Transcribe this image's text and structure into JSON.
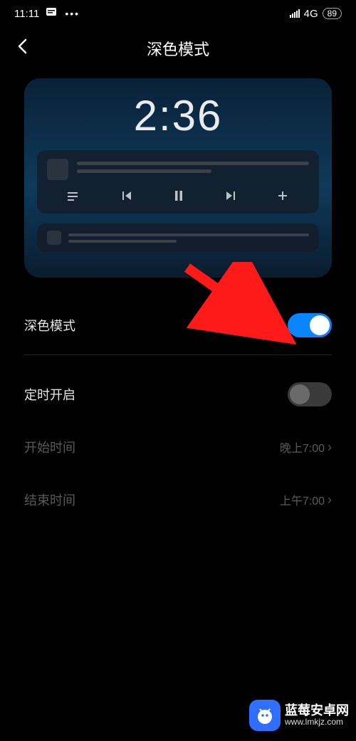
{
  "status": {
    "time": "11:11",
    "network": "4G",
    "battery": "89"
  },
  "header": {
    "title": "深色模式"
  },
  "preview": {
    "clock": "2:36"
  },
  "settings": {
    "darkMode": {
      "label": "深色模式",
      "on": true
    },
    "schedule": {
      "label": "定时开启",
      "on": false
    },
    "startTime": {
      "label": "开始时间",
      "value": "晚上7:00"
    },
    "endTime": {
      "label": "结束时间",
      "value": "上午7:00"
    }
  },
  "watermark": {
    "title": "蓝莓安卓网",
    "url": "www.lmkjz.com"
  }
}
